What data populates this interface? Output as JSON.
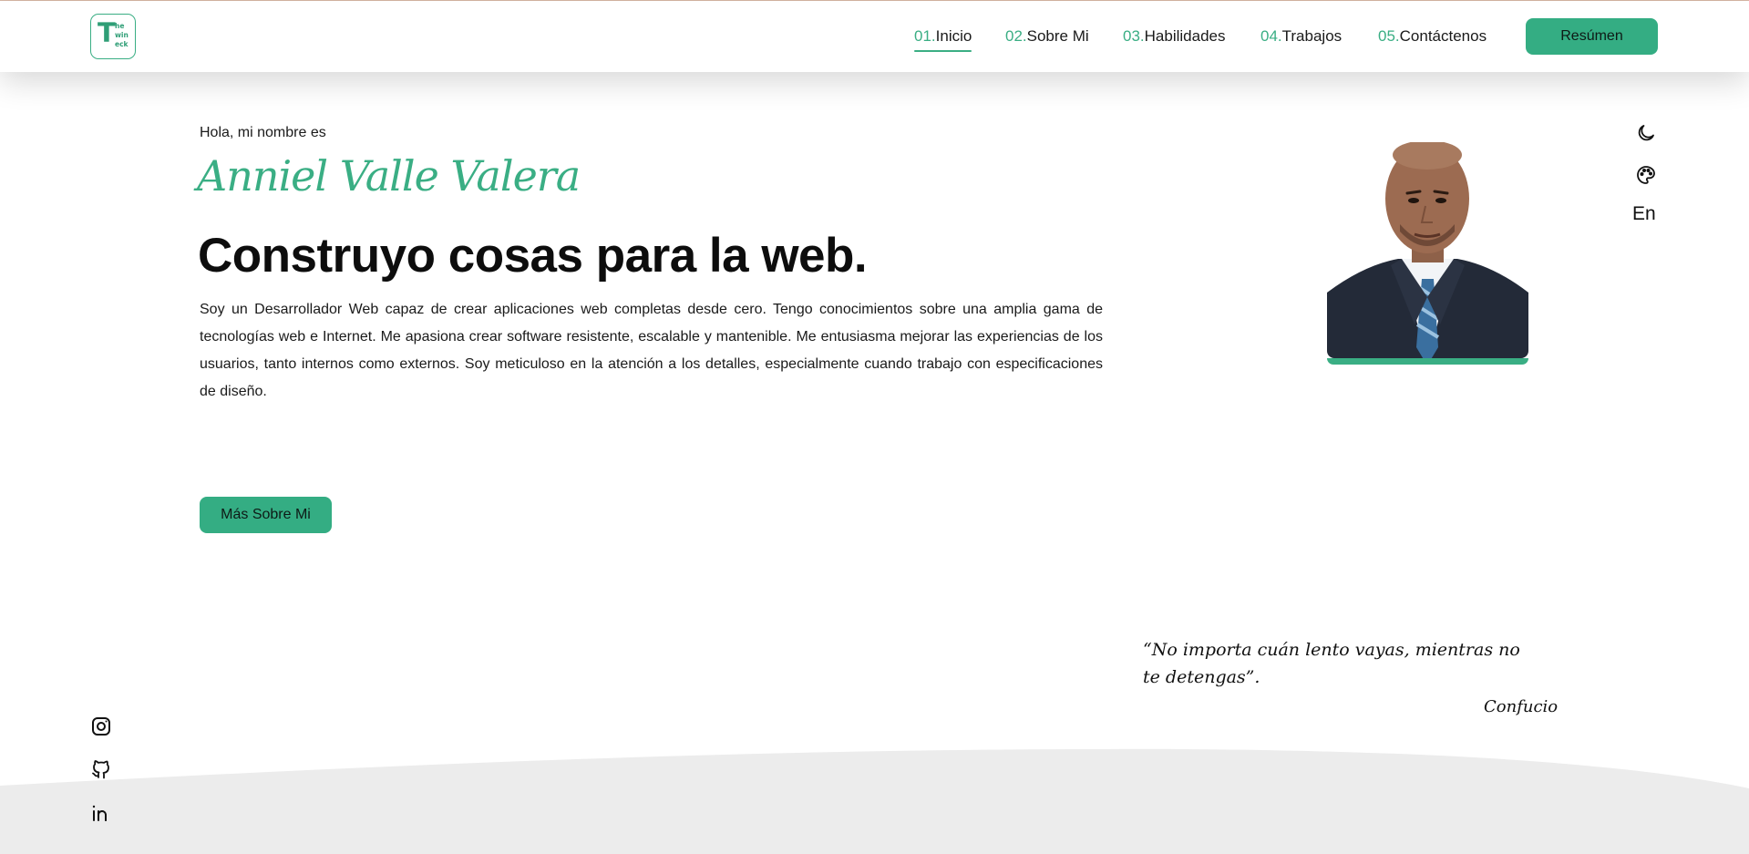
{
  "header": {
    "logo": {
      "big": "T",
      "small": [
        "he",
        "win",
        "eck"
      ]
    },
    "nav": [
      {
        "num": "01.",
        "label": "Inicio",
        "active": true
      },
      {
        "num": "02.",
        "label": "Sobre Mi"
      },
      {
        "num": "03.",
        "label": "Habilidades"
      },
      {
        "num": "04.",
        "label": "Trabajos"
      },
      {
        "num": "05.",
        "label": "Contáctenos"
      }
    ],
    "resume_label": "Resúmen"
  },
  "hero": {
    "greeting": "Hola, mi nombre es",
    "name": "Anniel Valle Valera",
    "tagline": "Construyo cosas para la web.",
    "about": "Soy un Desarrollador Web capaz de crear aplicaciones web completas desde cero. Tengo conocimientos sobre una amplia gama de tecnologías web e Internet. Me apasiona crear software resistente, escalable y mantenible. Me entusiasma mejorar las experiencias de los usuarios, tanto internos como externos. Soy meticuloso en la atención a los detalles, especialmente cuando trabajo con especificaciones de diseño.",
    "more_label": "Más Sobre Mi"
  },
  "settings": {
    "theme_icon": "moon-icon",
    "palette_icon": "palette-icon",
    "language": "En"
  },
  "quote": {
    "text": "“No importa cuán lento vayas, mientras no te detengas”.",
    "author": "Confucio"
  },
  "social": [
    "instagram-icon",
    "github-icon",
    "linkedin-icon"
  ],
  "colors": {
    "accent": "#3aae84",
    "button": "#34ad83",
    "wave": "#ececec"
  }
}
